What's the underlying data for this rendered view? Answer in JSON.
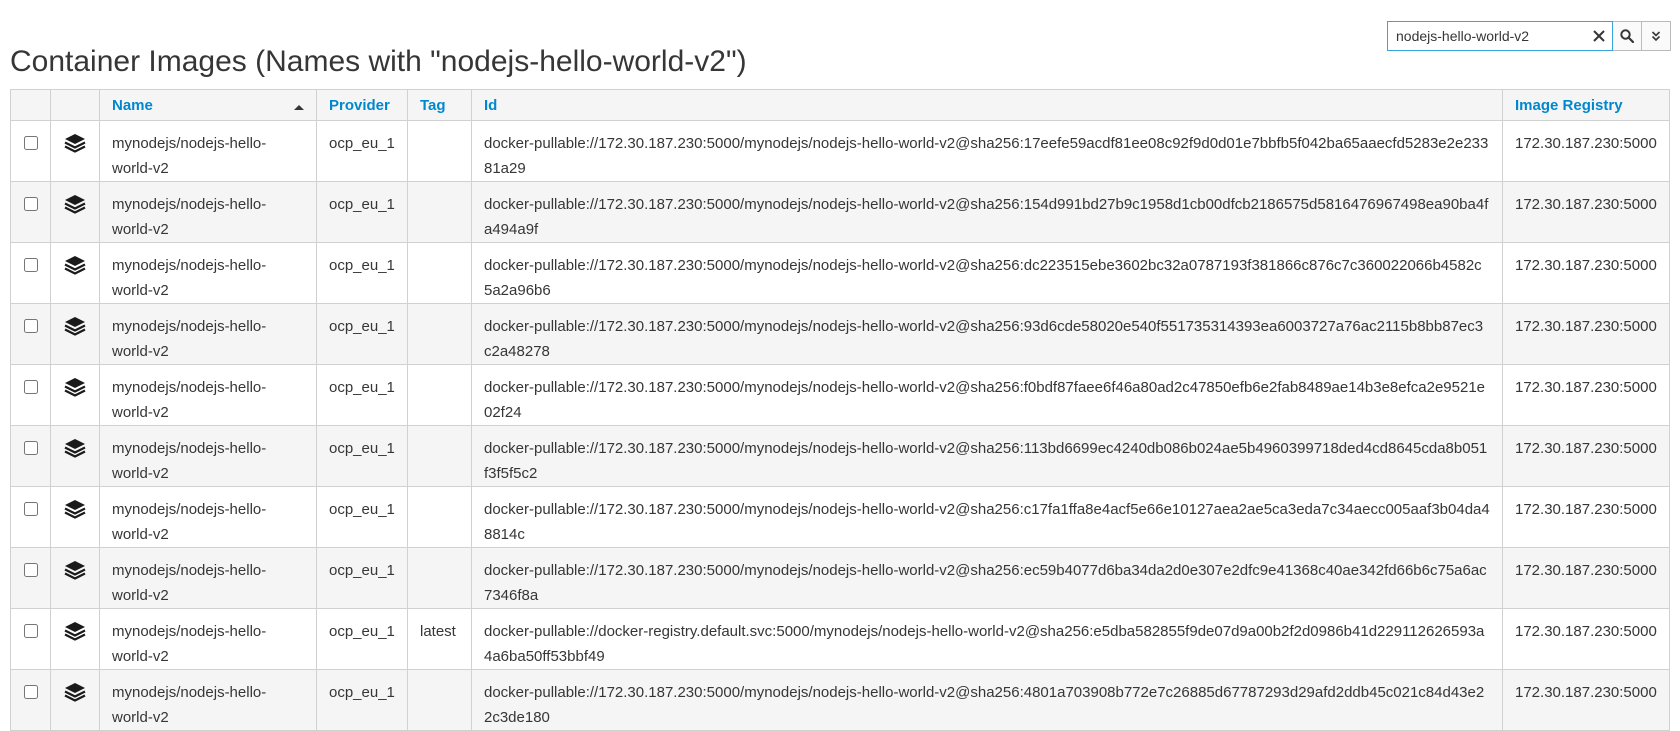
{
  "page": {
    "title": "Container Images (Names with \"nodejs-hello-world-v2\")"
  },
  "search": {
    "value": "nodejs-hello-world-v2",
    "placeholder": ""
  },
  "table": {
    "columns": {
      "name": "Name",
      "provider": "Provider",
      "tag": "Tag",
      "id": "Id",
      "registry": "Image Registry"
    },
    "rows": [
      {
        "name": "mynodejs/nodejs-hello-world-v2",
        "provider": "ocp_eu_1",
        "tag": "",
        "id": "docker-pullable://172.30.187.230:5000/mynodejs/nodejs-hello-world-v2@sha256:17eefe59acdf81ee08c92f9d0d01e7bbfb5f042ba65aaecfd5283e2e23381a29",
        "registry": "172.30.187.230:5000"
      },
      {
        "name": "mynodejs/nodejs-hello-world-v2",
        "provider": "ocp_eu_1",
        "tag": "",
        "id": "docker-pullable://172.30.187.230:5000/mynodejs/nodejs-hello-world-v2@sha256:154d991bd27b9c1958d1cb00dfcb2186575d5816476967498ea90ba4fa494a9f",
        "registry": "172.30.187.230:5000"
      },
      {
        "name": "mynodejs/nodejs-hello-world-v2",
        "provider": "ocp_eu_1",
        "tag": "",
        "id": "docker-pullable://172.30.187.230:5000/mynodejs/nodejs-hello-world-v2@sha256:dc223515ebe3602bc32a0787193f381866c876c7c360022066b4582c5a2a96b6",
        "registry": "172.30.187.230:5000"
      },
      {
        "name": "mynodejs/nodejs-hello-world-v2",
        "provider": "ocp_eu_1",
        "tag": "",
        "id": "docker-pullable://172.30.187.230:5000/mynodejs/nodejs-hello-world-v2@sha256:93d6cde58020e540f551735314393ea6003727a76ac2115b8bb87ec3c2a48278",
        "registry": "172.30.187.230:5000"
      },
      {
        "name": "mynodejs/nodejs-hello-world-v2",
        "provider": "ocp_eu_1",
        "tag": "",
        "id": "docker-pullable://172.30.187.230:5000/mynodejs/nodejs-hello-world-v2@sha256:f0bdf87faee6f46a80ad2c47850efb6e2fab8489ae14b3e8efca2e9521e02f24",
        "registry": "172.30.187.230:5000"
      },
      {
        "name": "mynodejs/nodejs-hello-world-v2",
        "provider": "ocp_eu_1",
        "tag": "",
        "id": "docker-pullable://172.30.187.230:5000/mynodejs/nodejs-hello-world-v2@sha256:113bd6699ec4240db086b024ae5b4960399718ded4cd8645cda8b051f3f5f5c2",
        "registry": "172.30.187.230:5000"
      },
      {
        "name": "mynodejs/nodejs-hello-world-v2",
        "provider": "ocp_eu_1",
        "tag": "",
        "id": "docker-pullable://172.30.187.230:5000/mynodejs/nodejs-hello-world-v2@sha256:c17fa1ffa8e4acf5e66e10127aea2ae5ca3eda7c34aecc005aaf3b04da48814c",
        "registry": "172.30.187.230:5000"
      },
      {
        "name": "mynodejs/nodejs-hello-world-v2",
        "provider": "ocp_eu_1",
        "tag": "",
        "id": "docker-pullable://172.30.187.230:5000/mynodejs/nodejs-hello-world-v2@sha256:ec59b4077d6ba34da2d0e307e2dfc9e41368c40ae342fd66b6c75a6ac7346f8a",
        "registry": "172.30.187.230:5000"
      },
      {
        "name": "mynodejs/nodejs-hello-world-v2",
        "provider": "ocp_eu_1",
        "tag": "latest",
        "id": "docker-pullable://docker-registry.default.svc:5000/mynodejs/nodejs-hello-world-v2@sha256:e5dba582855f9de07d9a00b2f2d0986b41d229112626593a4a6ba50ff53bbf49",
        "registry": "172.30.187.230:5000"
      },
      {
        "name": "mynodejs/nodejs-hello-world-v2",
        "provider": "ocp_eu_1",
        "tag": "",
        "id": "docker-pullable://172.30.187.230:5000/mynodejs/nodejs-hello-world-v2@sha256:4801a703908b772e7c26885d67787293d29afd2ddb45c021c84d43e22c3de180",
        "registry": "172.30.187.230:5000"
      }
    ]
  },
  "icons": {
    "row": "layers-icon",
    "clear": "close-icon",
    "search": "search-icon",
    "expand": "double-chevron-down-icon"
  },
  "colors": {
    "link": "#0088ce",
    "focus": "#39a5dc"
  }
}
